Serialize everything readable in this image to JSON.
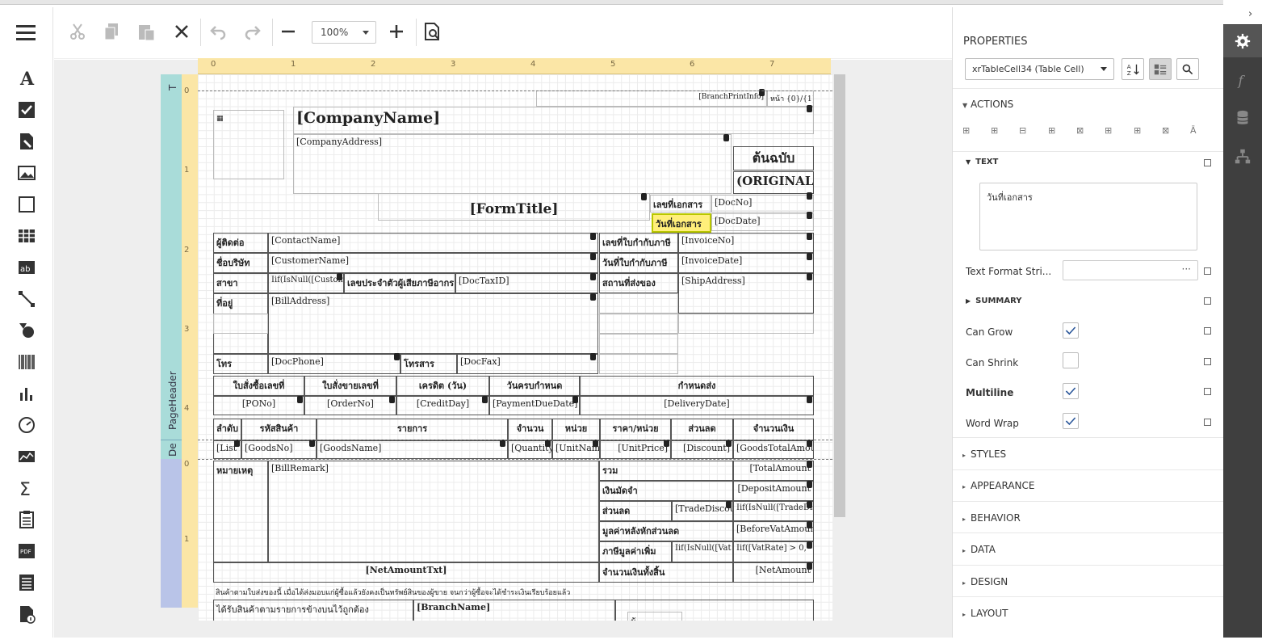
{
  "toolbar": {
    "zoom_value": "100%"
  },
  "bands": {
    "page_header": "PageHeader",
    "detail": "De",
    "top": "T"
  },
  "ruler": {
    "top_ticks": [
      "0",
      "1",
      "2",
      "3",
      "4",
      "5",
      "6",
      "7"
    ],
    "left_ticks_header": [
      "0",
      "1",
      "2",
      "3",
      "4"
    ],
    "left_ticks_footer": [
      "0",
      "1"
    ]
  },
  "report": {
    "branch_print_info": "[BranchPrintInfo]",
    "page_info": "หน้า {0}/{1}",
    "company_name": "[CompanyName]",
    "company_address": "[CompanyAddress]",
    "original_th": "ต้นฉบับ",
    "original_en": "(ORIGINAL)",
    "form_title": "[FormTitle]",
    "doc_no_label": "เลขที่เอกสาร",
    "doc_no": "[DocNo]",
    "doc_date_label": "วันที่เอกสาร",
    "doc_date": "[DocDate]",
    "contact_label": "ผู้ติดต่อ",
    "contact_name": "[ContactName]",
    "invoice_no_label": "เลขที่ใบกำกับภาษี",
    "invoice_no": "[InvoiceNo]",
    "company_label": "ชื่อบริษัท",
    "customer_name": "[CustomerName]",
    "invoice_date_label": "วันที่ใบกำกับภาษี",
    "invoice_date": "[InvoiceDate]",
    "branch_label": "สาขา",
    "branch_expr": "Iif(IsNull([Custom",
    "tax_id_label": "เลขประจำตัวผู้เสียภาษีอากร",
    "doc_tax_id": "[DocTaxID]",
    "ship_label": "สถานที่ส่งของ",
    "ship_address": "[ShipAddress]",
    "address_label": "ที่อยู่",
    "bill_address": "[BillAddress]",
    "phone_label": "โทร",
    "doc_phone": "[DocPhone]",
    "fax_label": "โทรสาร",
    "doc_fax": "[DocFax]",
    "po_label": "ใบสั่งซื้อเลขที่",
    "order_label": "ใบสั่งขายเลขที่",
    "credit_label": "เครดิต (วัน)",
    "due_label": "วันครบกำหนด",
    "delivery_label": "กำหนดส่ง",
    "po_no": "[PONo]",
    "order_no": "[OrderNo]",
    "credit_day": "[CreditDay]",
    "payment_due": "[PaymentDueDate]",
    "delivery_date": "[DeliveryDate]",
    "col_seq": "ลำดับ",
    "col_code": "รหัสสินค้า",
    "col_desc": "รายการ",
    "col_qty": "จำนวน",
    "col_unit": "หน่วย",
    "col_price": "ราคา/หน่วย",
    "col_discount": "ส่วนลด",
    "col_amount": "จำนวนเงิน",
    "d_list": "[List",
    "d_goods_no": "[GoodsNo]",
    "d_goods_name": "[GoodsName]",
    "d_quantity": "[Quantity]",
    "d_unit_name": "[UnitName]",
    "d_unit_price": "[UnitPrice]",
    "d_discount": "[Discount]",
    "d_goods_total": "[GoodsTotalAmount",
    "remark_label": "หมายเหตุ",
    "bill_remark": "[BillRemark]",
    "total_label": "รวม",
    "total_amount": "[TotalAmount",
    "deposit_label": "เงินมัดจำ",
    "deposit_amount": "[DepositAmount",
    "trade_discount_label": "ส่วนลด",
    "trade_discount": "[TradeDiscoun",
    "trade_discount_expr": "Iif(IsNull([TradeDis",
    "before_vat_label": "มูลค่าหลังหักส่วนลด",
    "before_vat": "[BeforeVatAmount",
    "vat_label": "ภาษีมูลค่าเพิ่ม",
    "vat_expr1": "Iif(IsNull([Vat",
    "vat_expr2": "Iif([VatRate] > 0,",
    "net_amount_txt": "[NetAmountTxt]",
    "grand_total_label": "จำนวนเงินทั้งสิ้น",
    "net_amount": "[NetAmount",
    "ownership_note": "สินค้าตามใบส่งของนี้ เมื่อได้ส่งมอบแก่ผู้ซื้อแล้วยังคงเป็นทรัพย์สินของผู้ขาย จนกว่าผู้ซื้อจะได้ชำระเงินเรียบร้อยแล้ว",
    "received_note": "ได้รับสินค้าตามรายการข้างบนไว้ถูกต้อง",
    "branch_name": "[BranchName]",
    "sign_partial": "ผู้"
  },
  "properties": {
    "title": "PROPERTIES",
    "selected_component": "xrTableCell34 (Table Cell)",
    "actions_label": "ACTIONS",
    "text_label": "TEXT",
    "text_value": "วันที่เอกสาร",
    "text_format_label": "Text Format Stri...",
    "text_format_button": "···",
    "summary_label": "SUMMARY",
    "can_grow_label": "Can Grow",
    "can_grow": true,
    "can_shrink_label": "Can Shrink",
    "can_shrink": false,
    "multiline_label": "Multiline",
    "multiline": true,
    "word_wrap_label": "Word Wrap",
    "word_wrap": true,
    "styles_label": "STYLES",
    "appearance_label": "APPEARANCE",
    "behavior_label": "BEHAVIOR",
    "data_label": "DATA",
    "design_label": "DESIGN",
    "layout_label": "LAYOUT"
  },
  "colors": {
    "accent_selection": "#ffef7a",
    "band_header": "#a9dcd9",
    "band_footer": "#b9c4e8",
    "ruler": "#fbe6a6",
    "sidebar": "#3f3f3f"
  }
}
